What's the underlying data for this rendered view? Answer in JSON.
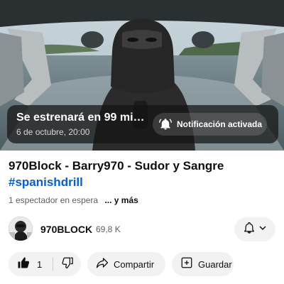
{
  "player": {
    "premiere_title": "Se estrenará en 99 minu…",
    "premiere_date": "6 de octubre, 20:00",
    "notification_label": "Notificación activada"
  },
  "video": {
    "title": "970Block - Barry970 - Sudor y Sangre",
    "hashtag": "#spanishdrill",
    "waiting_count": "1 espectador en espera",
    "more_label": "... y más"
  },
  "channel": {
    "name": "970BLOCK",
    "subscribers": "69,8 K"
  },
  "actions": {
    "like_count": "1",
    "share_label": "Compartir",
    "save_label": "Guardar"
  },
  "icons": {
    "notification": "bell-ringing-icon",
    "like": "thumbs-up-icon",
    "dislike": "thumbs-down-icon",
    "share": "share-arrow-icon",
    "save": "add-to-playlist-icon",
    "subscribe_bell": "bell-icon",
    "chevron": "chevron-down-icon"
  },
  "colors": {
    "hashtag": "#065fd4",
    "secondary_text": "#606060",
    "pill_background": "#f2f2f2"
  }
}
